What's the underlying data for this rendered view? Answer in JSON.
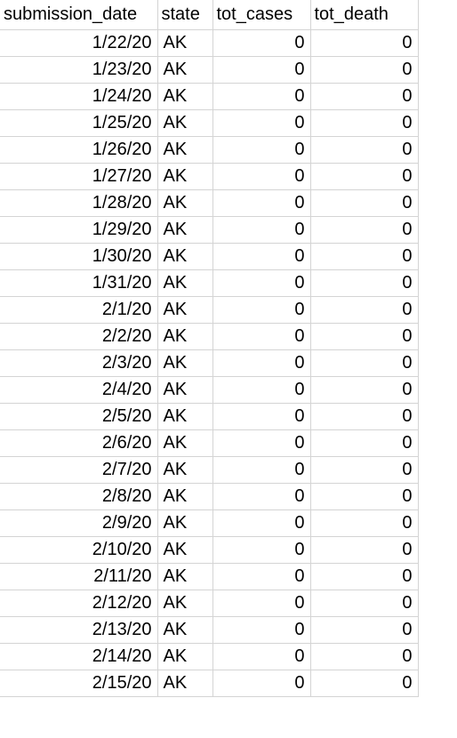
{
  "sheet": {
    "columns": [
      "submission_date",
      "state",
      "tot_cases",
      "tot_death"
    ],
    "rows": [
      [
        "1/22/20",
        "AK",
        "0",
        "0"
      ],
      [
        "1/23/20",
        "AK",
        "0",
        "0"
      ],
      [
        "1/24/20",
        "AK",
        "0",
        "0"
      ],
      [
        "1/25/20",
        "AK",
        "0",
        "0"
      ],
      [
        "1/26/20",
        "AK",
        "0",
        "0"
      ],
      [
        "1/27/20",
        "AK",
        "0",
        "0"
      ],
      [
        "1/28/20",
        "AK",
        "0",
        "0"
      ],
      [
        "1/29/20",
        "AK",
        "0",
        "0"
      ],
      [
        "1/30/20",
        "AK",
        "0",
        "0"
      ],
      [
        "1/31/20",
        "AK",
        "0",
        "0"
      ],
      [
        "2/1/20",
        "AK",
        "0",
        "0"
      ],
      [
        "2/2/20",
        "AK",
        "0",
        "0"
      ],
      [
        "2/3/20",
        "AK",
        "0",
        "0"
      ],
      [
        "2/4/20",
        "AK",
        "0",
        "0"
      ],
      [
        "2/5/20",
        "AK",
        "0",
        "0"
      ],
      [
        "2/6/20",
        "AK",
        "0",
        "0"
      ],
      [
        "2/7/20",
        "AK",
        "0",
        "0"
      ],
      [
        "2/8/20",
        "AK",
        "0",
        "0"
      ],
      [
        "2/9/20",
        "AK",
        "0",
        "0"
      ],
      [
        "2/10/20",
        "AK",
        "0",
        "0"
      ],
      [
        "2/11/20",
        "AK",
        "0",
        "0"
      ],
      [
        "2/12/20",
        "AK",
        "0",
        "0"
      ],
      [
        "2/13/20",
        "AK",
        "0",
        "0"
      ],
      [
        "2/14/20",
        "AK",
        "0",
        "0"
      ],
      [
        "2/15/20",
        "AK",
        "0",
        "0"
      ]
    ]
  },
  "colors": {
    "grid_line": "#d4d4d4",
    "text": "#000000",
    "background": "#ffffff"
  }
}
